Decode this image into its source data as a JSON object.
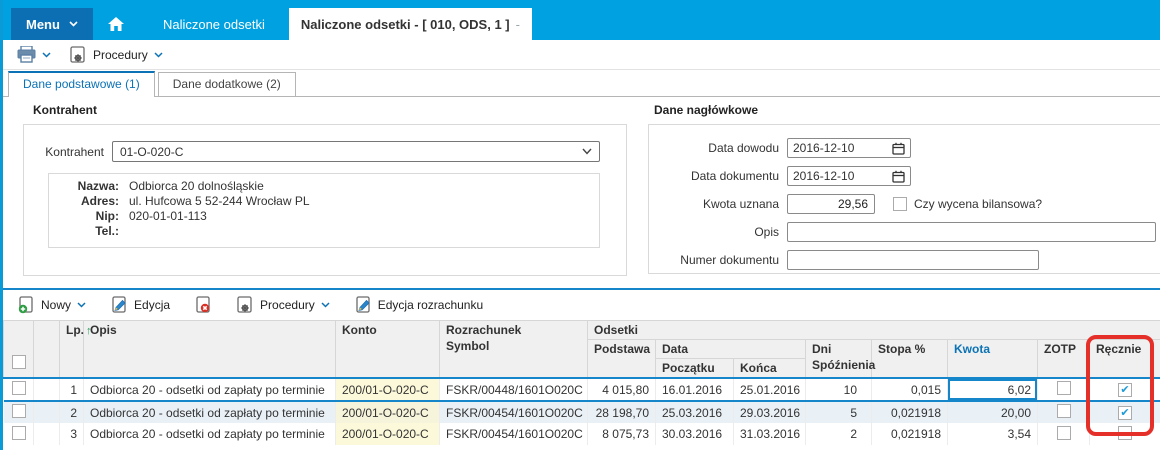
{
  "topbar": {
    "menu_label": "Menu",
    "tab_naliczone": "Naliczone odsetki",
    "active_tab": "Naliczone odsetki - [ 010, ODS, 1 ]",
    "active_tab_suffix": "-"
  },
  "toolbar": {
    "procedury_label": "Procedury"
  },
  "page_tabs": {
    "tab1": "Dane podstawowe (1)",
    "tab2": "Dane dodatkowe (2)"
  },
  "kontrahent": {
    "group_label": "Kontrahent",
    "field_label": "Kontrahent",
    "value": "01-O-020-C",
    "nazwa_label": "Nazwa:",
    "nazwa": "Odbiorca 20 dolnośląskie",
    "adres_label": "Adres:",
    "adres": "ul. Hufcowa 5 52-244 Wrocław PL",
    "nip_label": "Nip:",
    "nip": "020-01-01-113",
    "tel_label": "Tel.:",
    "tel": ""
  },
  "naglowek": {
    "group_label": "Dane nagłówkowe",
    "data_dowodu_label": "Data dowodu",
    "data_dowodu": "2016-12-10",
    "data_dokumentu_label": "Data dokumentu",
    "data_dokumentu": "2016-12-10",
    "kwota_uznana_label": "Kwota uznana",
    "kwota_uznana": "29,56",
    "wycena_label": "Czy wycena bilansowa?",
    "opis_label": "Opis",
    "opis": "",
    "numer_label": "Numer dokumentu",
    "numer": ""
  },
  "actions": {
    "nowy": "Nowy",
    "edycja": "Edycja",
    "procedury": "Procedury",
    "edycja_rozrachunku": "Edycja rozrachunku"
  },
  "icons": {
    "sort_asc": "↑",
    "check": "✔"
  },
  "grid": {
    "headers": {
      "lp": "Lp.",
      "opis": "Opis",
      "konto": "Konto",
      "rozrachunek": "Rozrachunek",
      "symbol": "Symbol",
      "odsetki": "Odsetki",
      "podstawa": "Podstawa",
      "data": "Data",
      "poczatku": "Początku",
      "konca": "Końca",
      "dni": "Dni",
      "spoznienia": "Spóźnienia",
      "stopa": "Stopa %",
      "kwota": "Kwota",
      "zotp": "ZOTP",
      "recznie": "Ręcznie"
    },
    "rows": [
      {
        "lp": "1",
        "opis": "Odbiorca 20 - odsetki od zapłaty po terminie",
        "konto": "200/01-O-020-C",
        "rozrachunek": "FSKR/00448/1601O020C",
        "podstawa": "4 015,80",
        "poczatku": "16.01.2016",
        "konca": "25.01.2016",
        "dni": "10",
        "stopa": "0,015",
        "kwota": "6,02",
        "zotp_check": "",
        "recznie_check": "✔"
      },
      {
        "lp": "2",
        "opis": "Odbiorca 20 - odsetki od zapłaty po terminie",
        "konto": "200/01-O-020-C",
        "rozrachunek": "FSKR/00454/1601O020C",
        "podstawa": "28 198,70",
        "poczatku": "25.03.2016",
        "konca": "29.03.2016",
        "dni": "5",
        "stopa": "0,021918",
        "kwota": "20,00",
        "zotp_check": "",
        "recznie_check": "✔"
      },
      {
        "lp": "3",
        "opis": "Odbiorca 20 - odsetki od zapłaty po terminie",
        "konto": "200/01-O-020-C",
        "rozrachunek": "FSKR/00454/1601O020C",
        "podstawa": "8 075,73",
        "poczatku": "30.03.2016",
        "konca": "31.03.2016",
        "dni": "2",
        "stopa": "0,021918",
        "kwota": "3,54",
        "zotp_check": "",
        "recznie_check": ""
      }
    ]
  }
}
